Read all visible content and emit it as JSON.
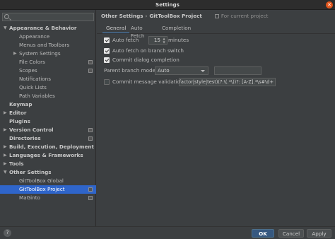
{
  "window": {
    "title": "Settings",
    "close_glyph": "✕"
  },
  "sidebar": {
    "search_placeholder": "",
    "items": [
      {
        "label": "Appearance & Behavior",
        "expanded": true,
        "bold": true
      },
      {
        "label": "Appearance"
      },
      {
        "label": "Menus and Toolbars"
      },
      {
        "label": "System Settings",
        "collapsed": true
      },
      {
        "label": "File Colors",
        "project_icon": true
      },
      {
        "label": "Scopes",
        "project_icon": true
      },
      {
        "label": "Notifications"
      },
      {
        "label": "Quick Lists"
      },
      {
        "label": "Path Variables"
      },
      {
        "label": "Keymap",
        "bold": true
      },
      {
        "label": "Editor",
        "bold": true,
        "collapsed": true
      },
      {
        "label": "Plugins",
        "bold": true
      },
      {
        "label": "Version Control",
        "bold": true,
        "collapsed": true,
        "project_icon": true
      },
      {
        "label": "Directories",
        "bold": true,
        "project_icon": true
      },
      {
        "label": "Build, Execution, Deployment",
        "bold": true,
        "collapsed": true
      },
      {
        "label": "Languages & Frameworks",
        "bold": true,
        "collapsed": true
      },
      {
        "label": "Tools",
        "bold": true,
        "collapsed": true
      },
      {
        "label": "Other Settings",
        "bold": true,
        "expanded": true
      },
      {
        "label": "GitToolBox Global"
      },
      {
        "label": "GitToolBox Project",
        "selected": true,
        "project_icon": true
      },
      {
        "label": "MaGinto",
        "project_icon": true
      }
    ]
  },
  "breadcrumb": {
    "parent": "Other Settings",
    "separator": "›",
    "current": "GitToolBox Project",
    "scope": "For current project"
  },
  "tabs": [
    {
      "label": "General",
      "active": true
    },
    {
      "label": "Auto Fetch"
    },
    {
      "label": "Completion"
    }
  ],
  "general": {
    "auto_fetch": {
      "label": "Auto fetch",
      "checked": true,
      "value": "15",
      "unit": "minutes"
    },
    "auto_fetch_branch_switch": {
      "label": "Auto fetch on branch switch",
      "checked": true
    },
    "commit_dialog_completion": {
      "label": "Commit dialog completion",
      "checked": true
    },
    "parent_branch_mode": {
      "label": "Parent branch mode",
      "value": "Auto",
      "extra_value": ""
    },
    "commit_message_validation": {
      "label": "Commit message validation",
      "checked": false,
      "regex": "(?:fix|chore|docs|feat|refactor|style|test)(?:\\(.*\\))?: [A-Z].*\\s#\\d+"
    }
  },
  "footer": {
    "help_label": "?",
    "ok_label": "OK",
    "cancel_label": "Cancel",
    "apply_label": "Apply"
  },
  "colors": {
    "selection": "#2f65ca",
    "primary_button": "#365880",
    "tab_underline": "#4a88c7",
    "close_button": "#e2571e"
  }
}
